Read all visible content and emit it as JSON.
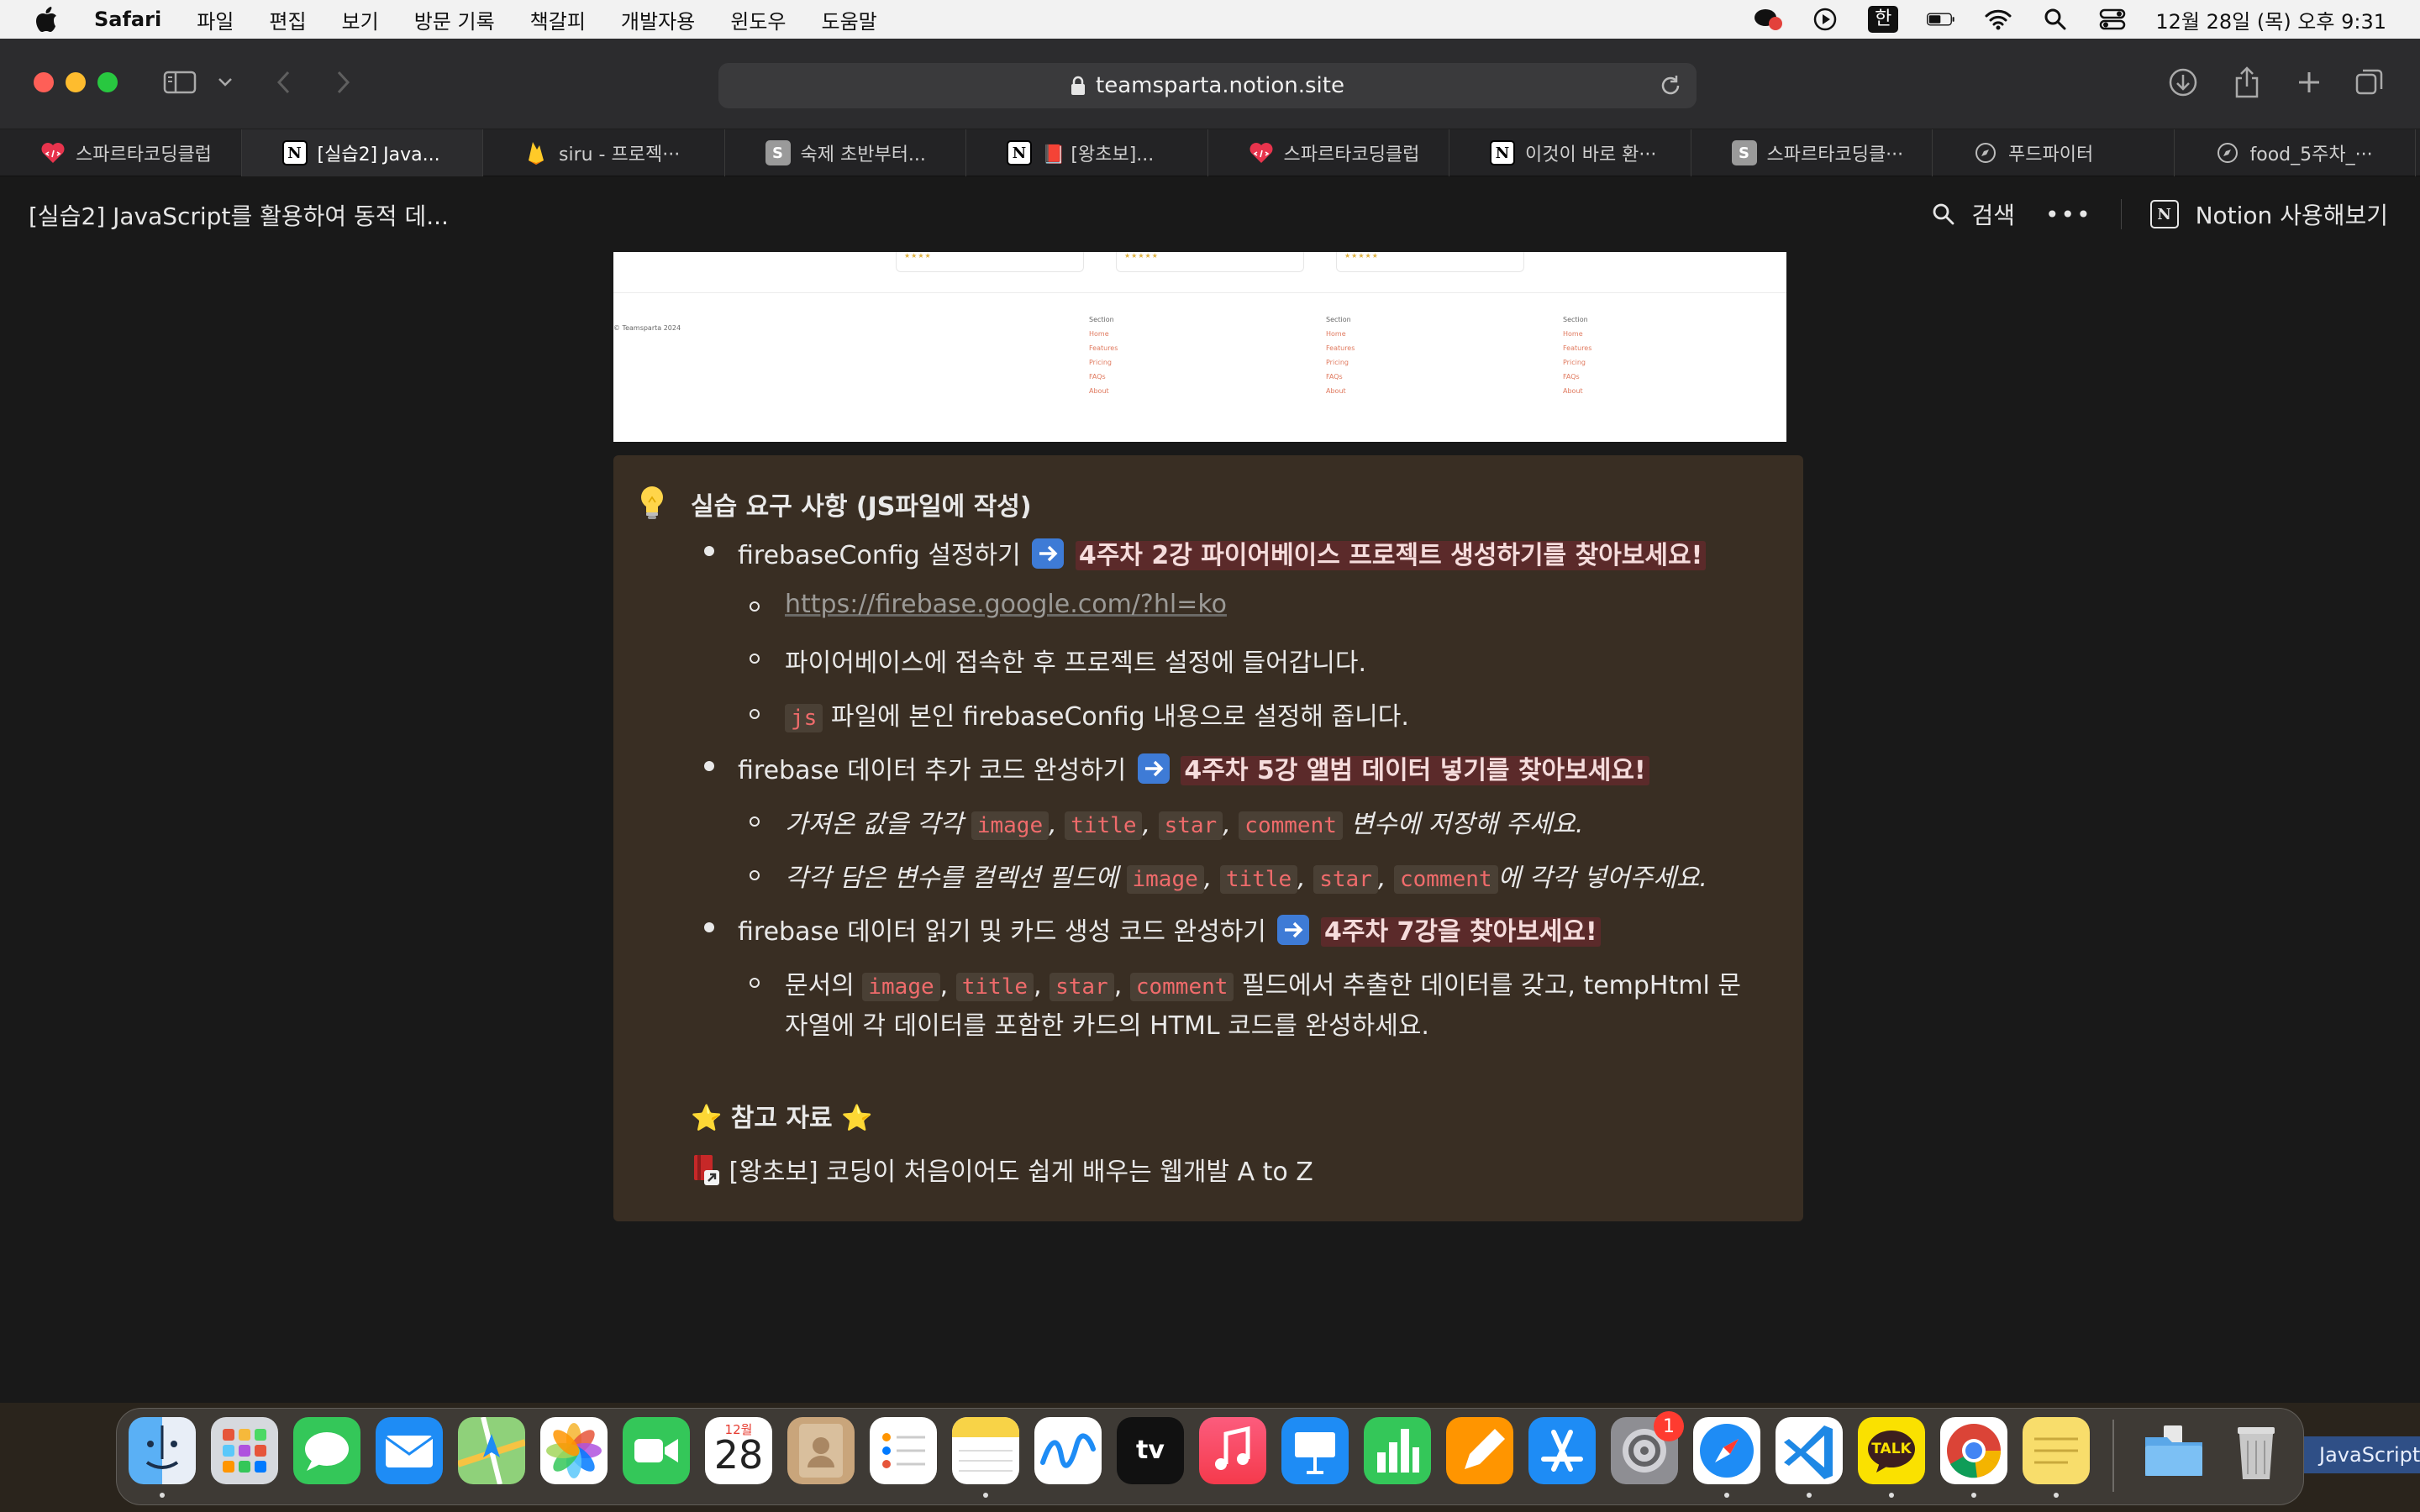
{
  "menubar": {
    "app_name": "Safari",
    "items": [
      "파일",
      "편집",
      "보기",
      "방문 기록",
      "책갈피",
      "개발자용",
      "윈도우",
      "도움말"
    ],
    "input_method": "한",
    "datetime": "12월 28일 (목) 오후 9:31"
  },
  "toolbar": {
    "url": "teamsparta.notion.site"
  },
  "tabs": [
    {
      "label": "스파르타코딩클럽",
      "icon": "sparta-heart-icon"
    },
    {
      "label": "[실습2] Java...",
      "icon": "notion-icon"
    },
    {
      "label": "siru - 프로젝···",
      "icon": "firebase-icon"
    },
    {
      "label": "숙제 초반부터...",
      "icon": "s-icon"
    },
    {
      "label": "📕 [왕초보]...",
      "icon": "notion-icon"
    },
    {
      "label": "스파르타코딩클럽",
      "icon": "sparta-heart-icon"
    },
    {
      "label": "이것이 바로 환···",
      "icon": "notion-icon"
    },
    {
      "label": "스파르타코딩클···",
      "icon": "s-icon"
    },
    {
      "label": "푸드파이터",
      "icon": "compass-icon"
    },
    {
      "label": "food_5주차_···",
      "icon": "compass-icon"
    }
  ],
  "notion_topbar": {
    "page_title": "[실습2] JavaScript를 활용하여 동적 데...",
    "search_label": "검색",
    "more_label": "•••",
    "try_notion_label": "Notion 사용해보기"
  },
  "embed": {
    "footer_copyright": "© Teamsparta 2024",
    "footer_section_title": "Section",
    "footer_links": [
      "Home",
      "Features",
      "Pricing",
      "FAQs",
      "About"
    ]
  },
  "callout": {
    "icon": "lightbulb-icon",
    "title": "실습 요구 사항 (JS파일에 작성)",
    "item1": {
      "text": "firebaseConfig 설정하기",
      "highlight": "4주차 2강 파이어베이스 프로젝트 생성하기를 찾아보세요!",
      "sub1_link": "https://firebase.google.com/?hl=ko",
      "sub2": "파이어베이스에 접속한 후 프로젝트 설정에 들어갑니다.",
      "sub3_code": "js",
      "sub3_text": "파일에 본인 firebaseConfig 내용으로 설정해 줍니다."
    },
    "item2": {
      "text": "firebase 데이터 추가 코드 완성하기",
      "highlight": "4주차 5강 앨범 데이터 넣기를 찾아보세요!",
      "sub1_prefix": "가져온 값을 각각",
      "sub1_suffix": "변수에 저장해 주세요.",
      "sub2_prefix": "각각 담은 변수를 컬렉션 필드에",
      "sub2_suffix": "에 각각 넣어주세요."
    },
    "item3": {
      "text": "firebase 데이터 읽기 및 카드 생성 코드 완성하기",
      "highlight": "4주차 7강을 찾아보세요!",
      "sub1_prefix": "문서의",
      "sub1_suffix": "필드에서 추출한 데이터를 갖고,  tempHtml 문",
      "sub1_line2": "자열에 각 데이터를 포함한 카드의 HTML 코드를 완성하세요."
    },
    "code_fields": [
      "image",
      "title",
      "star",
      "comment"
    ],
    "comma": ",",
    "reference_title": "⭐ 참고 자료 ⭐",
    "reference_link": "[왕초보] 코딩이 처음이어도 쉽게 배우는 웹개발 A to Z"
  },
  "dock": {
    "calendar_month": "12월",
    "calendar_day": "28",
    "settings_badge": "1",
    "tv_label": "tv",
    "talk_label": "TALK",
    "hover_label": "JavaScript"
  },
  "colors": {
    "callout_bg": "#392e23",
    "highlight_bg": "#5b2a2a",
    "code_red": "#ef6b6b",
    "arrow_blue": "#3e7bd6"
  }
}
